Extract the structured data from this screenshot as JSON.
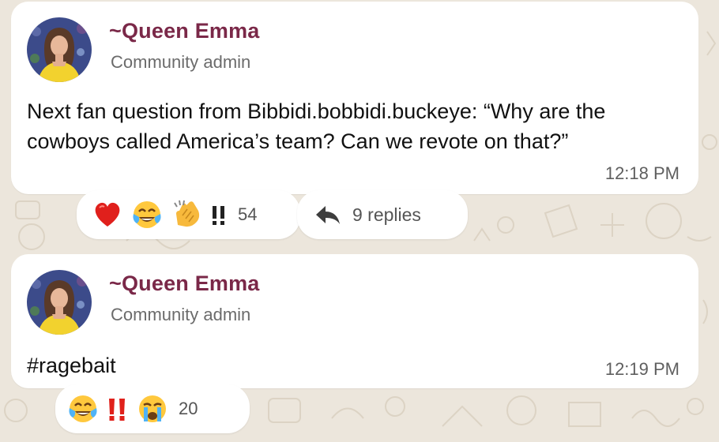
{
  "messages": [
    {
      "sender": "~Queen Emma",
      "role": "Community admin",
      "text": "Next fan question from Bibbidi.bobbidi.buckeye: “Why are the cowboys called America’s team? Can we revote on that?”",
      "time": "12:18 PM",
      "reactions": [
        "red-heart",
        "face-with-tears-of-joy",
        "clapping-hands",
        "double-exclamation"
      ],
      "reaction_count": "54",
      "replies": "9 replies"
    },
    {
      "sender": "~Queen Emma",
      "role": "Community admin",
      "text": "#ragebait",
      "time": "12:19 PM",
      "reactions": [
        "face-with-tears-of-joy",
        "double-exclamation",
        "loudly-crying-face"
      ],
      "reaction_count": "20"
    }
  ],
  "colors": {
    "background": "#ECE6DC",
    "bubble": "#FFFFFF",
    "sender": "#7A2848",
    "role": "#6B6B6B",
    "text": "#111111",
    "time": "#5F5F5F",
    "exclamation": "#E0211B"
  }
}
